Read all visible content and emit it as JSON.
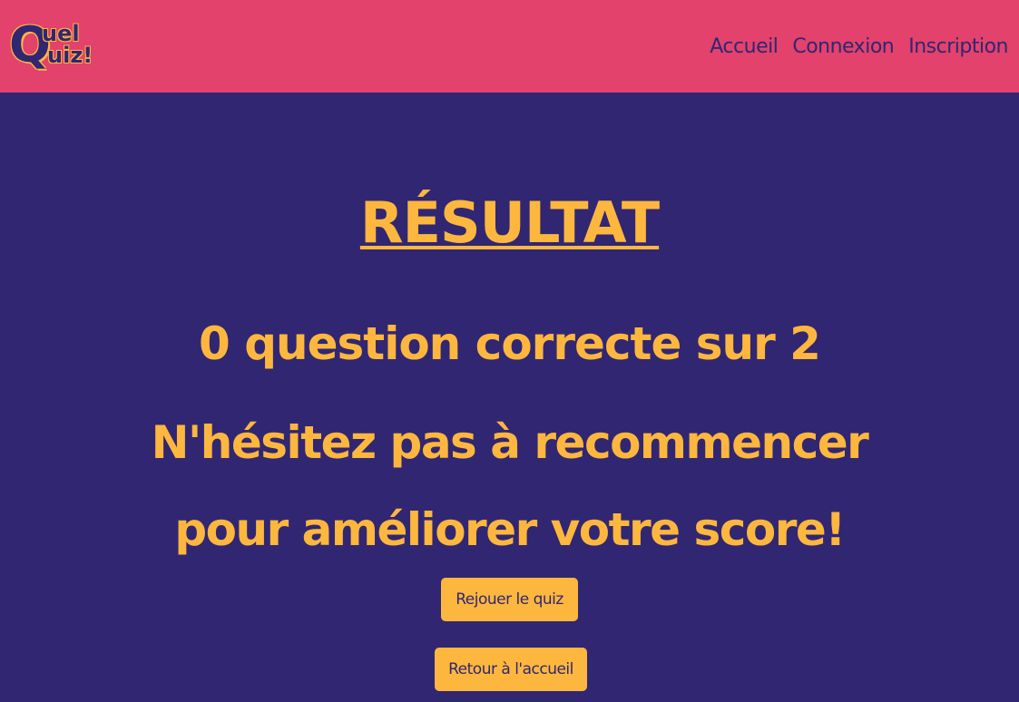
{
  "header": {
    "logo": {
      "line1_first": "Q",
      "line1_rest": "uel",
      "line2_rest": "uiz!"
    },
    "nav": [
      {
        "label": "Accueil"
      },
      {
        "label": "Connexion"
      },
      {
        "label": "Inscription"
      }
    ]
  },
  "result": {
    "title": "RÉSULTAT",
    "score_text": "0 question correcte sur 2",
    "encouragement": "N'hésitez pas à recommencer pour améliorer votre score!"
  },
  "buttons": {
    "replay": "Rejouer le quiz",
    "home": "Retour à l'accueil"
  },
  "colors": {
    "header_bg": "#e2426b",
    "page_bg": "#312672",
    "accent": "#fdb73e"
  }
}
